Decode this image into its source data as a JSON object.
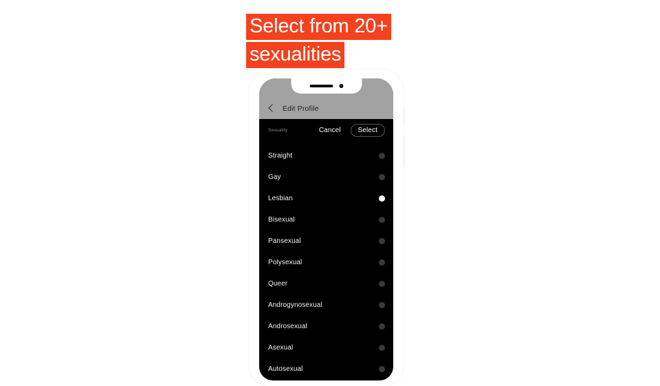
{
  "headline": {
    "lines": [
      "Select from 20+",
      "sexualities"
    ],
    "highlight_color": "#f4411e",
    "text_color": "#ffffff"
  },
  "phone": {
    "notch": {
      "speaker_icon": "speaker-bar-icon",
      "camera_icon": "front-camera-icon"
    },
    "navbar": {
      "back_icon": "back-chevron-icon",
      "title": "Edit Profile",
      "background_color": "#a2a2a2"
    },
    "action_row": {
      "field_label": "Sexuality",
      "cancel_label": "Cancel",
      "select_label": "Select"
    },
    "options": [
      {
        "label": "Straight",
        "selected": false
      },
      {
        "label": "Gay",
        "selected": false
      },
      {
        "label": "Lesbian",
        "selected": true
      },
      {
        "label": "Bisexual",
        "selected": false
      },
      {
        "label": "Pansexual",
        "selected": false
      },
      {
        "label": "Polysexual",
        "selected": false
      },
      {
        "label": "Queer",
        "selected": false
      },
      {
        "label": "Androgynosexual",
        "selected": false
      },
      {
        "label": "Androsexual",
        "selected": false
      },
      {
        "label": "Asexual",
        "selected": false
      },
      {
        "label": "Autosexual",
        "selected": false
      }
    ]
  }
}
